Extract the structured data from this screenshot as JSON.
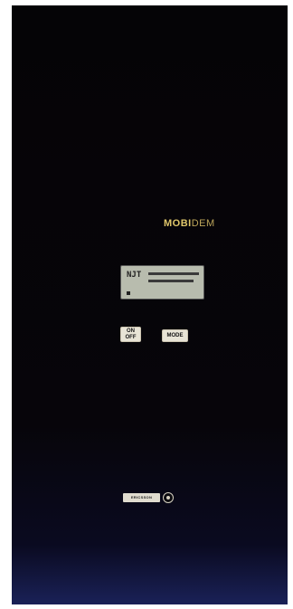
{
  "device": {
    "brand_part1": "MOBI",
    "brand_part2": "DEM",
    "display_lead": "NJT",
    "buttons": {
      "on_off_line1": "ON",
      "on_off_line2": "OFF",
      "mode": "MODE"
    },
    "footer_logo_text": "ERICSSON"
  }
}
